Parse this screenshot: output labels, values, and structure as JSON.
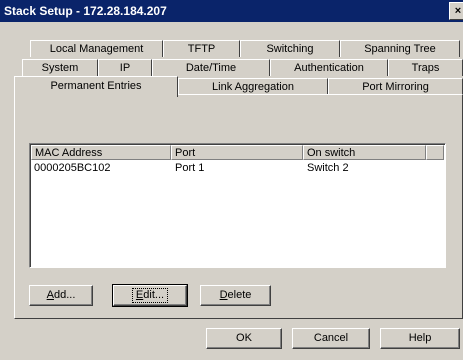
{
  "window": {
    "title": "Stack Setup - 172.28.184.207",
    "close_label": "×"
  },
  "tabs": {
    "row1": [
      "Local Management",
      "TFTP",
      "Switching",
      "Spanning Tree"
    ],
    "row2": [
      "System",
      "IP",
      "Date/Time",
      "Authentication",
      "Traps"
    ],
    "row3": [
      "Permanent Entries",
      "Link Aggregation",
      "Port Mirroring"
    ],
    "active": "Permanent Entries"
  },
  "table": {
    "columns": [
      "MAC Address",
      "Port",
      "On switch"
    ],
    "rows": [
      {
        "mac": "0000205BC102",
        "port": "Port 1",
        "switch": "Switch 2"
      }
    ]
  },
  "buttons": {
    "add": {
      "label": "Add...",
      "mnemonic": "A",
      "rest": "dd..."
    },
    "edit": {
      "label": "Edit...",
      "mnemonic": "E",
      "rest": "dit..."
    },
    "delete": {
      "label": "Delete",
      "mnemonic": "D",
      "rest": "elete"
    },
    "ok": "OK",
    "cancel": "Cancel",
    "help": "Help"
  }
}
